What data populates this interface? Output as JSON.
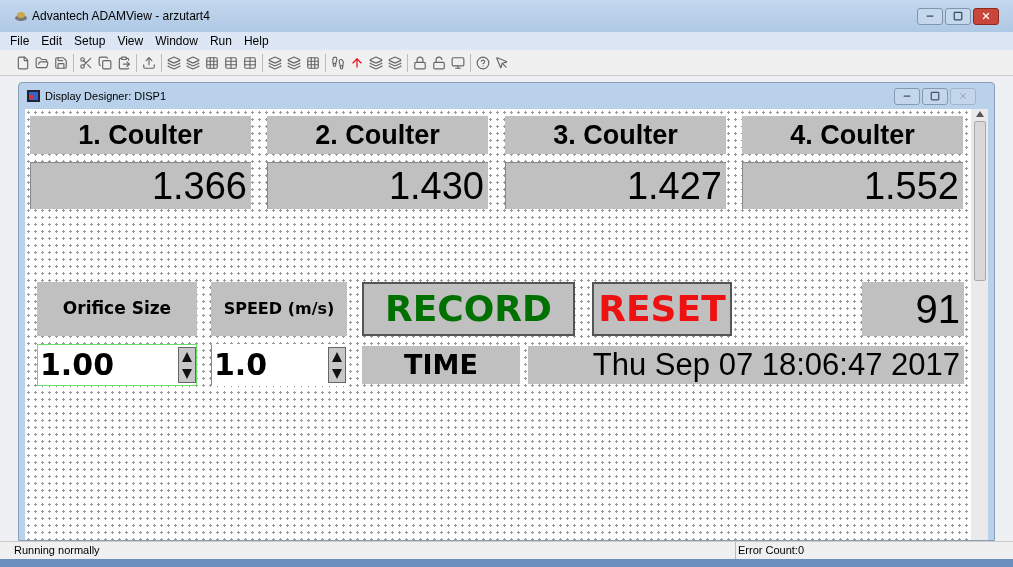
{
  "window": {
    "title": "Advantech ADAMView - arzutart4"
  },
  "menu": [
    "File",
    "Edit",
    "Setup",
    "View",
    "Window",
    "Run",
    "Help"
  ],
  "designer": {
    "title": "Display Designer: DISP1"
  },
  "coulters": [
    {
      "label": "1. Coulter",
      "value": "1.366"
    },
    {
      "label": "2. Coulter",
      "value": "1.430"
    },
    {
      "label": "3. Coulter",
      "value": "1.427"
    },
    {
      "label": "4. Coulter",
      "value": "1.552"
    }
  ],
  "orifice": {
    "label": "Orifice Size",
    "value": "1.00",
    "focused": true
  },
  "speed": {
    "label": "SPEED (m/s)",
    "value": "1.0",
    "focused": false
  },
  "buttons": [
    {
      "label": "RECORD",
      "color": "#007000"
    },
    {
      "label": "RESET",
      "color": "#ee1111"
    }
  ],
  "counter": "91",
  "time": {
    "label": "TIME",
    "value": "Thu Sep 07 18:06:47 2017"
  },
  "status_bar": {
    "message": "Running normally",
    "error_count": "Error Count:0"
  }
}
